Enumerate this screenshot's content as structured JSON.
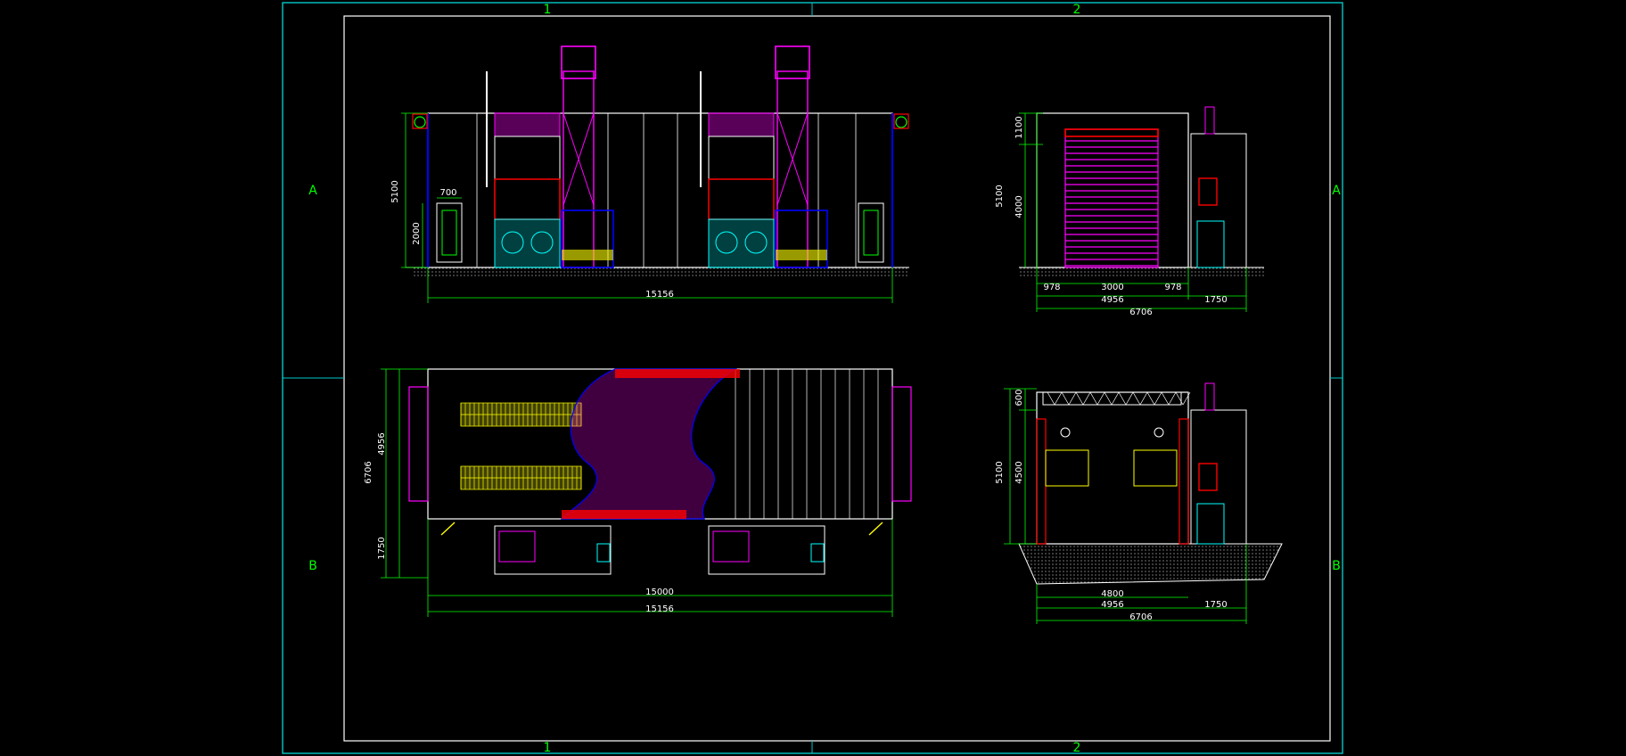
{
  "colors": {
    "background": "#000000",
    "frame": "#00c8c8",
    "inner_frame": "#ffffff",
    "dimension": "#00ff00",
    "structure": "#ffffff",
    "duct": "#ff00ff",
    "equipment_red": "#ff0000",
    "equipment_blue": "#0000ff",
    "equipment_cyan": "#00ffff",
    "equipment_yellow": "#ffff00"
  },
  "grid": {
    "col_1": "1",
    "col_2": "2",
    "row_a": "A",
    "row_b": "B"
  },
  "front_elevation": {
    "height_total": "5100",
    "door_height": "2000",
    "door_width": "700",
    "length": "15156"
  },
  "side_elevation": {
    "height_total": "5100",
    "height_top": "1100",
    "height_door": "4000",
    "left_margin": "978",
    "door_width": "3000",
    "right_margin": "978",
    "booth_width": "4956",
    "unit_width": "1750",
    "overall_width": "6706"
  },
  "plan": {
    "overall_width": "6706",
    "booth_width": "4956",
    "unit_width": "1750",
    "inner_length": "15000",
    "length": "15156"
  },
  "section": {
    "height_total": "5100",
    "height_top": "600",
    "height_inner": "4500",
    "pit_width": "4800",
    "booth_width": "4956",
    "unit_width": "1750",
    "overall_width": "6706"
  }
}
